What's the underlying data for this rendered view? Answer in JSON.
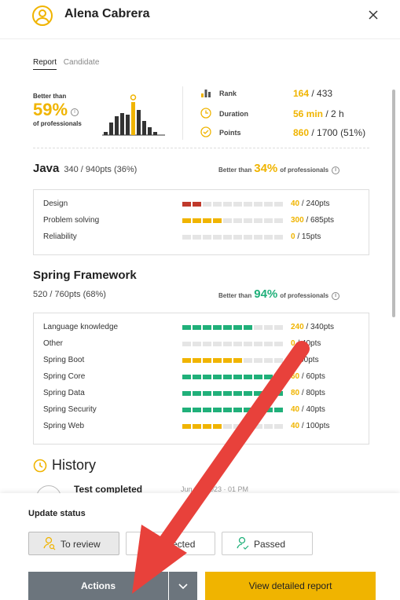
{
  "header": {
    "name": "Alena Cabrera"
  },
  "tabs": [
    {
      "label": "Report"
    },
    {
      "label": "Candidate"
    }
  ],
  "summary": {
    "better_than": "Better than",
    "percent": "59%",
    "of_professionals": "of professionals",
    "rank_label": "Rank",
    "rank_value": "164",
    "rank_total": " / 433",
    "duration_label": "Duration",
    "duration_value": "56 min",
    "duration_total": " / 2 h",
    "points_label": "Points",
    "points_value": "860",
    "points_total": " / 1700 (51%)"
  },
  "java": {
    "title": "Java",
    "score": "340 / 940pts (36%)",
    "bt_prefix": "Better than",
    "bt_percent": "34%",
    "bt_suffix": "of professionals",
    "rows": [
      {
        "label": "Design",
        "value": "40",
        "total": " / 240pts",
        "fill": 0.17,
        "color": "#c0392b"
      },
      {
        "label": "Problem solving",
        "value": "300",
        "total": " / 685pts",
        "fill": 0.44,
        "color": "#f0b400"
      },
      {
        "label": "Reliability",
        "value": "0",
        "total": " / 15pts",
        "fill": 0,
        "color": "#c0392b"
      }
    ]
  },
  "spring": {
    "title": "Spring Framework",
    "score": "520 / 760pts (68%)",
    "bt_prefix": "Better than",
    "bt_percent": "94%",
    "bt_suffix": "of professionals",
    "rows": [
      {
        "label": "Language knowledge",
        "value": "240",
        "total": " / 340pts",
        "fill": 0.71,
        "color": "#20b07a"
      },
      {
        "label": "Other",
        "value": "0",
        "total": " / 40pts",
        "fill": 0,
        "color": "#c0392b"
      },
      {
        "label": "Spring Boot",
        "value": "",
        "total": " / 100pts",
        "fill": 0.6,
        "color": "#f0b400"
      },
      {
        "label": "Spring Core",
        "value": "60",
        "total": " / 60pts",
        "fill": 1.0,
        "color": "#20b07a"
      },
      {
        "label": "Spring Data",
        "value": "80",
        "total": " / 80pts",
        "fill": 1.0,
        "color": "#20b07a"
      },
      {
        "label": "Spring Security",
        "value": "40",
        "total": " / 40pts",
        "fill": 1.0,
        "color": "#20b07a"
      },
      {
        "label": "Spring Web",
        "value": "40",
        "total": " / 100pts",
        "fill": 0.4,
        "color": "#f0b400"
      }
    ]
  },
  "history": {
    "title": "History",
    "item_title": "Test completed",
    "item_date": "Jun 08, 2023 · 01 PM"
  },
  "footer": {
    "update_status": "Update status",
    "to_review": "To review",
    "rejected": "Rejected",
    "passed": "Passed",
    "actions": "Actions",
    "view_report": "View detailed report"
  },
  "colors": {
    "accent": "#f0b400",
    "green": "#20b07a",
    "red": "#c0392b",
    "gray_button": "#6c757d",
    "arrow": "#e8413b"
  }
}
